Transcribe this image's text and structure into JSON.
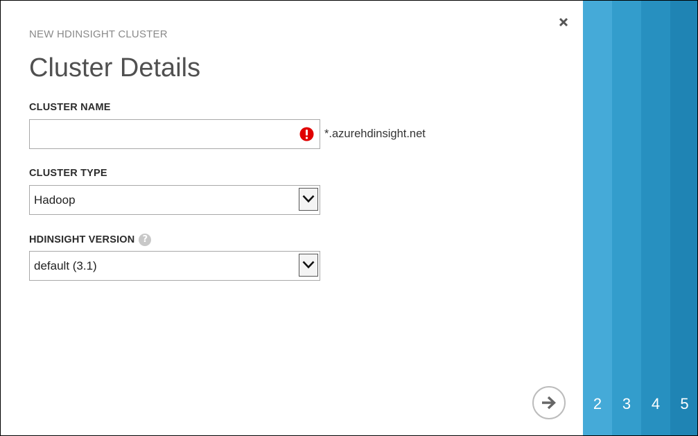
{
  "dialog": {
    "subtitle": "NEW HDINSIGHT CLUSTER",
    "title": "Cluster Details"
  },
  "form": {
    "cluster_name": {
      "label": "CLUSTER NAME",
      "value": "",
      "placeholder": "",
      "suffix": "*.azurehdinsight.net",
      "status": "error"
    },
    "cluster_type": {
      "label": "CLUSTER TYPE",
      "selected": "Hadoop"
    },
    "hdinsight_version": {
      "label": "HDINSIGHT VERSION",
      "help_glyph": "?",
      "selected": "default (3.1)"
    }
  },
  "wizard": {
    "close_glyph": "×",
    "next_icon": "arrow-right-icon",
    "steps": [
      {
        "label": "2",
        "color": "#45aad8"
      },
      {
        "label": "3",
        "color": "#339dcc"
      },
      {
        "label": "4",
        "color": "#2790c0"
      },
      {
        "label": "5",
        "color": "#1f84b4"
      }
    ]
  },
  "colors": {
    "error": "#e00000",
    "accent": "#45aad8"
  }
}
